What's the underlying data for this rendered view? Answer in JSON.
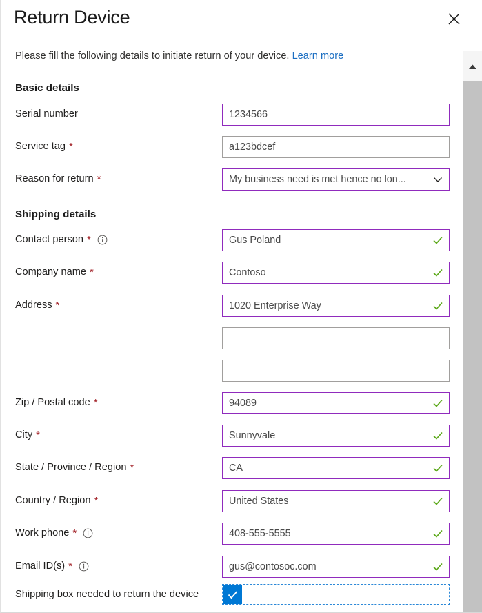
{
  "dialog": {
    "title": "Return Device",
    "close_label": "Close",
    "intro_text": "Please fill the following details to initiate return of your device.",
    "intro_link": "Learn more"
  },
  "sections": {
    "basic": {
      "heading": "Basic details"
    },
    "shipping": {
      "heading": "Shipping details"
    }
  },
  "fields": {
    "serial_number": {
      "label": "Serial number",
      "value": "1234566",
      "required": false
    },
    "service_tag": {
      "label": "Service tag",
      "value": "a123bdcef",
      "required": true
    },
    "reason_for_return": {
      "label": "Reason for return",
      "value": "My business need is met hence no lon...",
      "required": true
    },
    "contact_person": {
      "label": "Contact person",
      "value": "Gus Poland",
      "required": true
    },
    "company_name": {
      "label": "Company name",
      "value": "Contoso",
      "required": true
    },
    "address": {
      "label": "Address",
      "value": "1020 Enterprise Way",
      "required": true
    },
    "address_line2": {
      "label": "",
      "value": "",
      "required": false
    },
    "address_line3": {
      "label": "",
      "value": "",
      "required": false
    },
    "zip_postal_code": {
      "label": "Zip / Postal code",
      "value": "94089",
      "required": true
    },
    "city": {
      "label": "City",
      "value": "Sunnyvale",
      "required": true
    },
    "state_province_region": {
      "label": "State / Province / Region",
      "value": "CA",
      "required": true
    },
    "country_region": {
      "label": "Country / Region",
      "value": "United States",
      "required": true
    },
    "work_phone": {
      "label": "Work phone",
      "value": "408-555-5555",
      "required": true
    },
    "email_ids": {
      "label": "Email ID(s)",
      "value": "gus@contosoc.com",
      "required": true
    },
    "shipping_box": {
      "label": "Shipping box needed to return the device",
      "checked": true
    }
  },
  "icons": {
    "close": "close-icon",
    "info": "info-icon",
    "valid_check": "check-icon",
    "dropdown": "chevron-down-icon",
    "scroll_up": "scroll-up-arrow-icon",
    "checkbox_check": "checkmark-icon"
  },
  "colors": {
    "accent_border": "#902bbd",
    "default_border": "#a19f9d",
    "required_star": "#a4262c",
    "valid_check": "#5ca91a",
    "link": "#1b6ec2",
    "checkbox_fill": "#0078d4",
    "focus_outline": "#2b88d8",
    "scroll_thumb": "#c2c2c2"
  }
}
